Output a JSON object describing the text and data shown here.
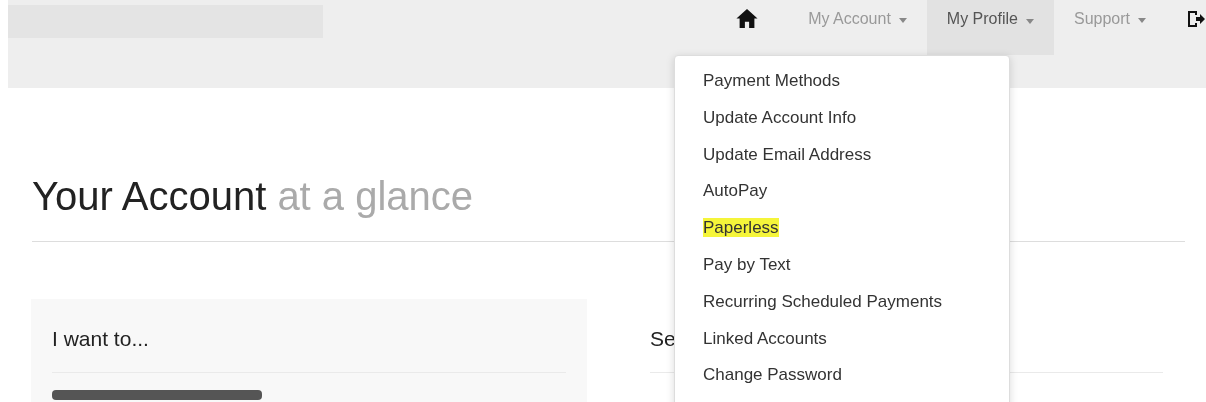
{
  "navbar": {
    "items": [
      {
        "label": "My Account",
        "selected": false
      },
      {
        "label": "My Profile",
        "selected": true
      },
      {
        "label": "Support",
        "selected": false
      }
    ]
  },
  "dropdown": {
    "items": [
      {
        "label": "Payment Methods",
        "highlighted": false
      },
      {
        "label": "Update Account Info",
        "highlighted": false
      },
      {
        "label": "Update Email Address",
        "highlighted": false
      },
      {
        "label": "AutoPay",
        "highlighted": false
      },
      {
        "label": "Paperless",
        "highlighted": true
      },
      {
        "label": "Pay by Text",
        "highlighted": false
      },
      {
        "label": "Recurring Scheduled Payments",
        "highlighted": false
      },
      {
        "label": "Linked Accounts",
        "highlighted": false
      },
      {
        "label": "Change Password",
        "highlighted": false
      }
    ]
  },
  "heading": {
    "main": "Your Account",
    "muted": "at a glance"
  },
  "left_panel": {
    "title": "I want to..."
  },
  "right_panel": {
    "title": "Se"
  }
}
